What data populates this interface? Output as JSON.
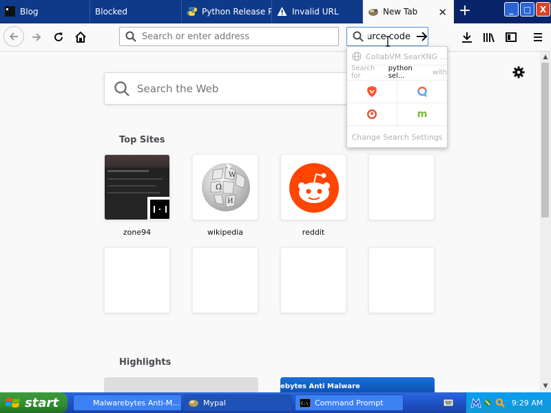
{
  "tabs": [
    {
      "label": "Blog"
    },
    {
      "label": "Blocked"
    },
    {
      "label": "Python Release Py"
    },
    {
      "label": "Invalid URL"
    },
    {
      "label": "New Tab",
      "active": true
    }
  ],
  "window_controls": {
    "minimize": "_",
    "maximize": "□",
    "close": "X"
  },
  "address_bar": {
    "value": "",
    "placeholder": "Search or enter address"
  },
  "search_bar": {
    "value": "python selenium source code"
  },
  "search_popup": {
    "engine_name": "CollabVM SearXNG ...",
    "search_for_prefix": "Search for",
    "search_for_query": "python sel...",
    "search_for_suffix": "with",
    "engines": [
      "brave",
      "qwant",
      "duckduckgo",
      "mojeek"
    ],
    "settings_label": "Change Search Settings"
  },
  "newtab": {
    "search_placeholder": "Search the Web",
    "top_sites_title": "Top Sites",
    "top_sites": [
      {
        "label": "zone94"
      },
      {
        "label": "wikipedia"
      },
      {
        "label": "reddit"
      },
      {
        "label": ""
      }
    ],
    "highlights_title": "Highlights",
    "highlight_card_text": "ebytes Anti Malware"
  },
  "taskbar": {
    "start_label": "start",
    "items": [
      {
        "label": "Malwarebytes Anti-M..."
      },
      {
        "label": "Mypal",
        "active": true
      },
      {
        "label": "Command Prompt"
      }
    ],
    "clock": "9:29 AM"
  },
  "colors": {
    "tab_strip": "#0a246a",
    "active_tab": "#f9f9fa",
    "reddit": "#ff4500",
    "brave": "#fb542b",
    "accent_blue": "#0060df"
  }
}
